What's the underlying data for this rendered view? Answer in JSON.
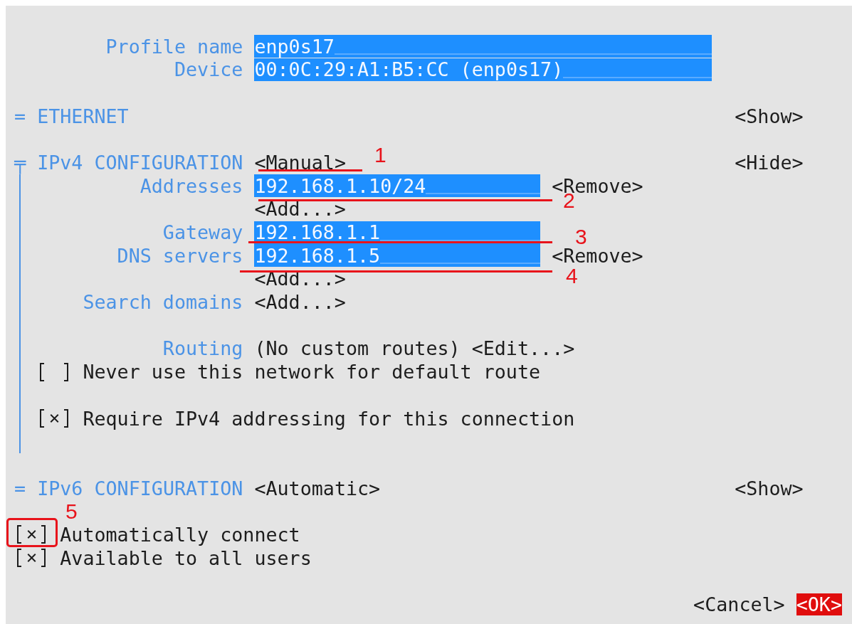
{
  "profile": [
    {
      "label": "Profile name",
      "value": "enp0s17"
    },
    {
      "label": "Device",
      "value": "00:0C:29:A1:B5:CC (enp0s17)"
    }
  ],
  "ethernet": {
    "marker": "=",
    "title": "ETHERNET",
    "toggle": "<Show>"
  },
  "ipv4": {
    "marker": "╤",
    "title": "IPv4 CONFIGURATION",
    "mode": "<Manual>",
    "toggle": "<Hide>",
    "rows": [
      {
        "kind": "field",
        "label": "Addresses",
        "value": "192.168.1.10/24",
        "action": "<Remove>"
      },
      {
        "kind": "button",
        "button": "<Add...>"
      },
      {
        "kind": "field",
        "label": "Gateway",
        "value": "192.168.1.1"
      },
      {
        "kind": "field",
        "label": "DNS servers",
        "value": "192.168.1.5",
        "action": "<Remove>"
      },
      {
        "kind": "button",
        "button": "<Add...>"
      },
      {
        "kind": "button",
        "label": "Search domains",
        "button": "<Add...>"
      },
      {
        "kind": "blank"
      },
      {
        "kind": "text",
        "label": "Routing",
        "text": "(No custom routes)",
        "button": "<Edit...>"
      },
      {
        "kind": "checkbox",
        "label": "Never use this network for default route",
        "checked": false
      },
      {
        "kind": "blank"
      },
      {
        "kind": "checkbox",
        "label": "Require IPv4 addressing for this connection",
        "checked": true
      }
    ]
  },
  "ipv6": {
    "marker": "=",
    "title": "IPv6 CONFIGURATION",
    "mode": "<Automatic>",
    "toggle": "<Show>"
  },
  "options": [
    {
      "label": "Automatically connect",
      "checked": true
    },
    {
      "label": "Available to all users",
      "checked": true
    }
  ],
  "buttons": [
    {
      "label": "<Cancel>",
      "focused": false
    },
    {
      "label": "<OK>",
      "focused": true
    }
  ],
  "annotations": [
    {
      "kind": "underline",
      "number": "1"
    },
    {
      "kind": "underline",
      "number": "2"
    },
    {
      "kind": "underline",
      "number": "3"
    },
    {
      "kind": "underline",
      "number": "4"
    },
    {
      "kind": "box",
      "number": "5"
    }
  ]
}
